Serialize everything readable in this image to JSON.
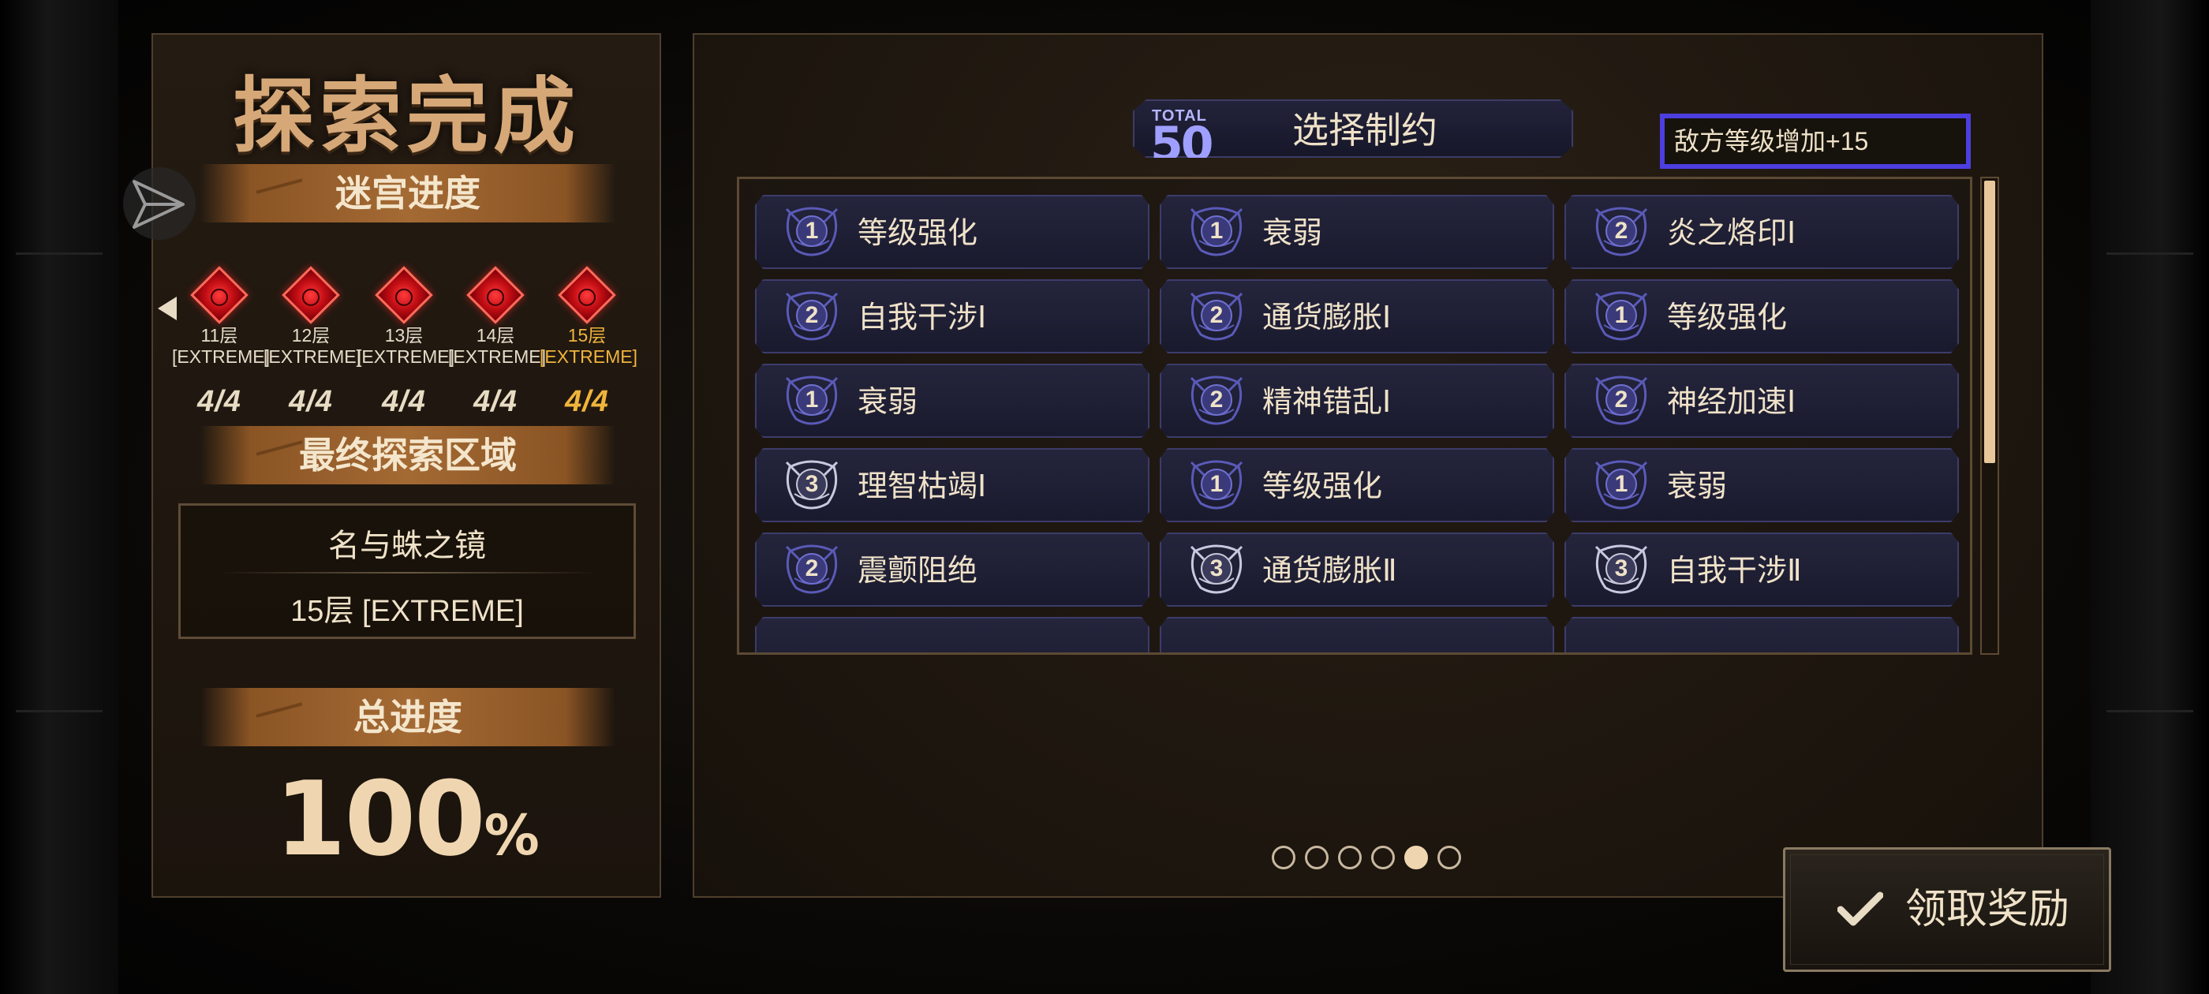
{
  "left": {
    "title": "探索完成",
    "maze_progress_label": "迷宫进度",
    "floors": [
      {
        "name": "11层",
        "difficulty": "[EXTREME]",
        "count": "4/4",
        "active": false
      },
      {
        "name": "12层",
        "difficulty": "[EXTREME]",
        "count": "4/4",
        "active": false
      },
      {
        "name": "13层",
        "difficulty": "[EXTREME]",
        "count": "4/4",
        "active": false
      },
      {
        "name": "14层",
        "difficulty": "[EXTREME]",
        "count": "4/4",
        "active": false
      },
      {
        "name": "15层",
        "difficulty": "[EXTREME]",
        "count": "4/4",
        "active": true
      }
    ],
    "final_area_label": "最终探索区域",
    "final_area_name": "名与蛛之镜",
    "final_area_floor": "15层 [EXTREME]",
    "total_progress_label": "总进度",
    "total_progress_value": "100",
    "total_progress_unit": "%"
  },
  "right": {
    "total_label": "TOTAL",
    "total_value": "50",
    "select_title": "选择制约",
    "enemy_level_text": "敌方等级增加+15",
    "constraints": [
      {
        "level": "1",
        "label": "等级强化"
      },
      {
        "level": "1",
        "label": "衰弱"
      },
      {
        "level": "2",
        "label": "炎之烙印Ⅰ"
      },
      {
        "level": "2",
        "label": "自我干涉Ⅰ"
      },
      {
        "level": "2",
        "label": "通货膨胀Ⅰ"
      },
      {
        "level": "1",
        "label": "等级强化"
      },
      {
        "level": "1",
        "label": "衰弱"
      },
      {
        "level": "2",
        "label": "精神错乱Ⅰ"
      },
      {
        "level": "2",
        "label": "神经加速Ⅰ"
      },
      {
        "level": "3",
        "label": "理智枯竭Ⅰ"
      },
      {
        "level": "1",
        "label": "等级强化"
      },
      {
        "level": "1",
        "label": "衰弱"
      },
      {
        "level": "2",
        "label": "震颤阻绝"
      },
      {
        "level": "3",
        "label": "通货膨胀Ⅱ"
      },
      {
        "level": "3",
        "label": "自我干涉Ⅱ"
      }
    ],
    "scroll_fraction_visible": 0.6,
    "pager": {
      "total": 6,
      "active_index": 4
    },
    "claim_button_label": "领取奖励"
  },
  "icons": {
    "share": "share-icon",
    "back": "arrow-left-icon",
    "check": "checkmark-icon",
    "floor_marker": "diamond-seal-icon",
    "constraint_emblem": "ornate-emblem-icon"
  },
  "colors": {
    "accent_gold": "#f0b43c",
    "title_orange": "#d6a878",
    "card_bg": "#1a1a2e",
    "enemy_box_border": "#4d3ee0",
    "floor_marker_red": "#c10d14"
  }
}
